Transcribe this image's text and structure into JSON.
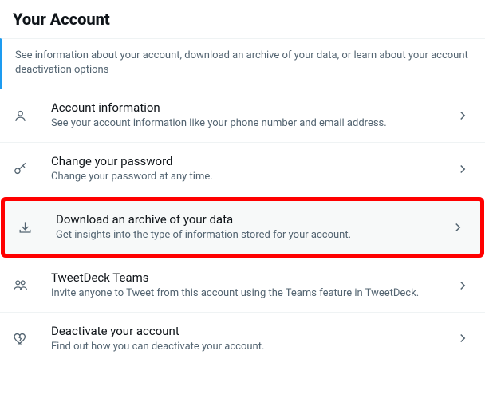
{
  "header": {
    "title": "Your Account"
  },
  "intro": {
    "text": "See information about your account, download an archive of your data, or learn about your account deactivation options"
  },
  "items": [
    {
      "title": "Account information",
      "desc": "See your account information like your phone number and email address."
    },
    {
      "title": "Change your password",
      "desc": "Change your password at any time."
    },
    {
      "title": "Download an archive of your data",
      "desc": "Get insights into the type of information stored for your account."
    },
    {
      "title": "TweetDeck Teams",
      "desc": "Invite anyone to Tweet from this account using the Teams feature in TweetDeck."
    },
    {
      "title": "Deactivate your account",
      "desc": "Find out how you can deactivate your account."
    }
  ]
}
